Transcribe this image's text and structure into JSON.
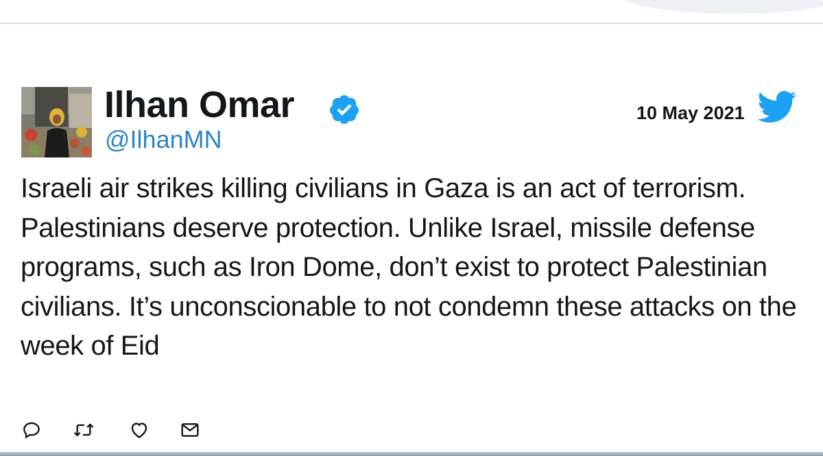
{
  "tweet": {
    "author_name": "Ilhan Omar",
    "handle": "@IlhanMN",
    "date": "10 May 2021",
    "text": "Israeli air strikes killing civilians in Gaza is an act of terrorism. Palestinians deserve protection. Unlike Israel, missile defense programs, such as Iron Dome, don’t exist to protect Palestinian civilians. It’s unconscionable to not condemn these attacks on the week of Eid",
    "verified": true
  },
  "icons": {
    "verified": "verified-badge-icon",
    "brand": "twitter-bird-icon",
    "reply": "reply-icon",
    "retweet": "retweet-icon",
    "like": "like-heart-icon",
    "message": "direct-message-icon"
  },
  "colors": {
    "twitter_blue": "#1da1f2",
    "handle_blue": "#2b84c4",
    "text": "#14171a"
  }
}
